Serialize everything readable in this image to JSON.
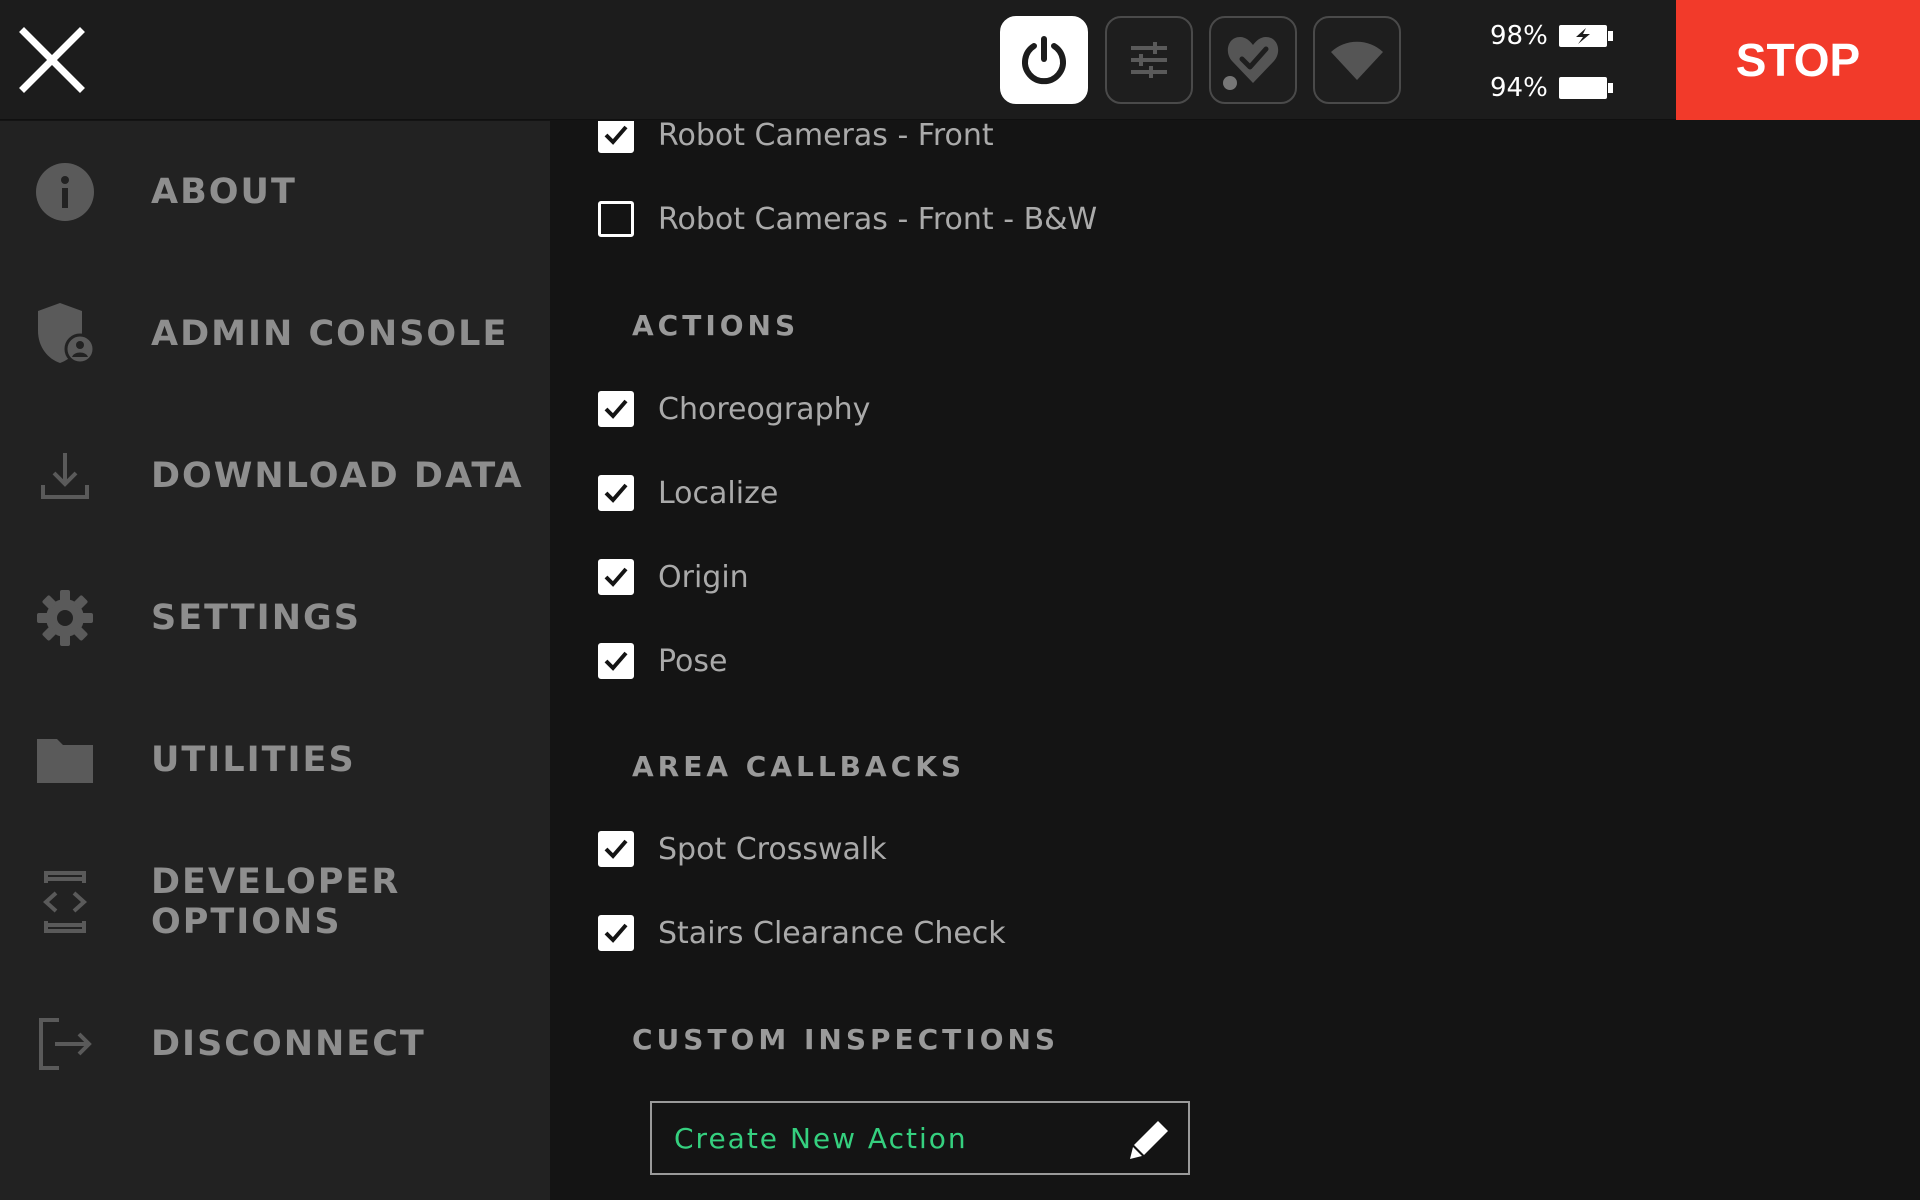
{
  "topbar": {
    "battery_1": "98%",
    "battery_2": "94%",
    "stop_label": "STOP",
    "icons": [
      "close-icon",
      "power-icon",
      "sliders-icon",
      "heart-check-icon",
      "wifi-icon",
      "battery-charging-icon",
      "battery-icon"
    ]
  },
  "sidebar": {
    "items": [
      {
        "label": "ABOUT",
        "icon": "info-icon"
      },
      {
        "label": "ADMIN CONSOLE",
        "icon": "shield-user-icon"
      },
      {
        "label": "DOWNLOAD DATA",
        "icon": "download-icon"
      },
      {
        "label": "SETTINGS",
        "icon": "gear-icon"
      },
      {
        "label": "UTILITIES",
        "icon": "folder-icon"
      },
      {
        "label": "DEVELOPER OPTIONS",
        "icon": "code-device-icon"
      },
      {
        "label": "DISCONNECT",
        "icon": "logout-icon"
      }
    ]
  },
  "main": {
    "cameras": [
      {
        "label": "Robot Cameras - Front",
        "checked": true
      },
      {
        "label": "Robot Cameras - Front - B&W",
        "checked": false
      }
    ],
    "actions_header": "ACTIONS",
    "actions": [
      {
        "label": "Choreography",
        "checked": true
      },
      {
        "label": "Localize",
        "checked": true
      },
      {
        "label": "Origin",
        "checked": true
      },
      {
        "label": "Pose",
        "checked": true
      }
    ],
    "area_callbacks_header": "AREA CALLBACKS",
    "area_callbacks": [
      {
        "label": "Spot Crosswalk",
        "checked": true
      },
      {
        "label": "Stairs Clearance Check",
        "checked": true
      }
    ],
    "custom_inspections_header": "CUSTOM INSPECTIONS",
    "create_action_label": "Create New Action"
  },
  "colors": {
    "stop": "#f23a2a",
    "accent_green": "#35d07f",
    "sidebar_bg": "#222222",
    "main_bg": "#141414"
  }
}
